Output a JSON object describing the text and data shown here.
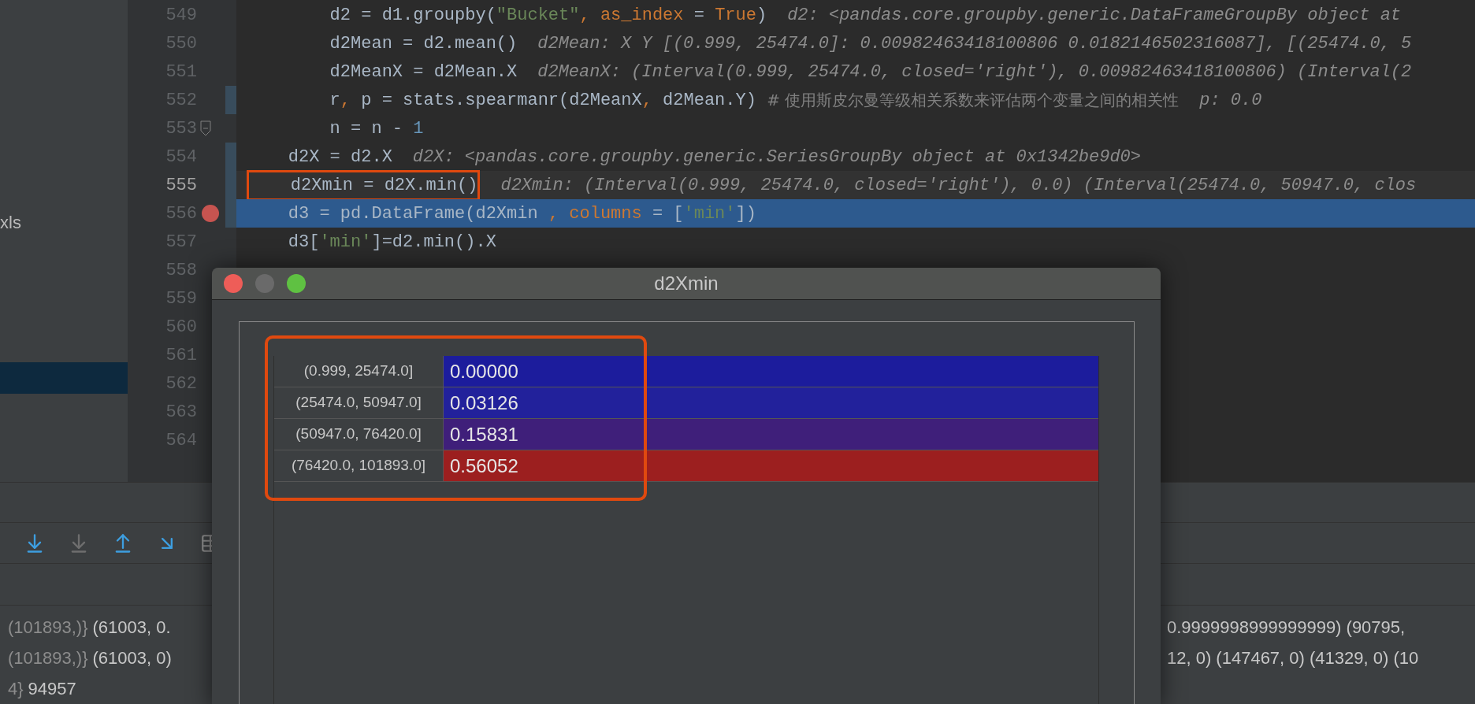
{
  "sidebar": {
    "items": [
      {
        "label": "xls"
      }
    ]
  },
  "editor": {
    "lines": [
      {
        "number": "549",
        "outlined": false,
        "current": false,
        "highlighted": false,
        "breakpoint": false,
        "changed": false,
        "fold": false,
        "tokens": [
          {
            "kind": "code",
            "text": "        d2 = d1.groupby("
          },
          {
            "kind": "str",
            "text": "\"Bucket\""
          },
          {
            "kind": "kw",
            "text": ", as_index"
          },
          {
            "kind": "code",
            "text": " = "
          },
          {
            "kind": "kw",
            "text": "True"
          },
          {
            "kind": "code",
            "text": ")"
          },
          {
            "kind": "hint",
            "text": "d2: <pandas.core.groupby.generic.DataFrameGroupBy object at"
          }
        ]
      },
      {
        "number": "550",
        "outlined": false,
        "current": false,
        "highlighted": false,
        "breakpoint": false,
        "changed": false,
        "fold": false,
        "tokens": [
          {
            "kind": "code",
            "text": "        d2Mean = d2.mean()"
          },
          {
            "kind": "hint",
            "text": "d2Mean: X Y [(0.999, 25474.0]: 0.00982463418100806 0.0182146502316087], [(25474.0, 5"
          }
        ]
      },
      {
        "number": "551",
        "outlined": false,
        "current": false,
        "highlighted": false,
        "breakpoint": false,
        "changed": false,
        "fold": false,
        "tokens": [
          {
            "kind": "code",
            "text": "        d2MeanX = d2Mean.X"
          },
          {
            "kind": "hint",
            "text": "d2MeanX: (Interval(0.999, 25474.0, closed='right'), 0.00982463418100806) (Interval(2"
          }
        ]
      },
      {
        "number": "552",
        "outlined": false,
        "current": false,
        "highlighted": false,
        "breakpoint": false,
        "changed": true,
        "fold": false,
        "tokens": [
          {
            "kind": "code",
            "text": "        r"
          },
          {
            "kind": "kw",
            "text": ","
          },
          {
            "kind": "code",
            "text": " p = stats.spearmanr(d2MeanX"
          },
          {
            "kind": "kw",
            "text": ","
          },
          {
            "kind": "code",
            "text": " d2Mean.Y) "
          },
          {
            "kind": "comment",
            "text": "# 使用斯皮尔曼等级相关系数来评估两个变量之间的相关性"
          },
          {
            "kind": "hint",
            "text": "p: 0.0"
          }
        ]
      },
      {
        "number": "553",
        "outlined": false,
        "current": false,
        "highlighted": false,
        "breakpoint": false,
        "changed": false,
        "fold": true,
        "tokens": [
          {
            "kind": "code",
            "text": "        n = n - "
          },
          {
            "kind": "num",
            "text": "1"
          }
        ]
      },
      {
        "number": "554",
        "outlined": false,
        "current": false,
        "highlighted": false,
        "breakpoint": false,
        "changed": true,
        "fold": false,
        "tokens": [
          {
            "kind": "code",
            "text": "    d2X = d2.X"
          },
          {
            "kind": "hint",
            "text": "d2X: <pandas.core.groupby.generic.SeriesGroupBy object at 0x1342be9d0>"
          }
        ]
      },
      {
        "number": "555",
        "outlined": true,
        "current": true,
        "highlighted": false,
        "breakpoint": false,
        "changed": true,
        "fold": false,
        "tokens": [
          {
            "kind": "code",
            "text": "    d2Xmin = d2X.min()"
          },
          {
            "kind": "hint",
            "text": "d2Xmin: (Interval(0.999, 25474.0, closed='right'), 0.0) (Interval(25474.0, 50947.0, clos"
          }
        ]
      },
      {
        "number": "556",
        "outlined": false,
        "current": false,
        "highlighted": true,
        "breakpoint": true,
        "changed": true,
        "fold": false,
        "tokens": [
          {
            "kind": "code",
            "text": "    d3 = pd.DataFrame(d2Xmin "
          },
          {
            "kind": "kw",
            "text": ", columns"
          },
          {
            "kind": "code",
            "text": " = ["
          },
          {
            "kind": "str",
            "text": "'min'"
          },
          {
            "kind": "code",
            "text": "])"
          }
        ]
      },
      {
        "number": "557",
        "outlined": false,
        "current": false,
        "highlighted": false,
        "breakpoint": false,
        "changed": false,
        "fold": false,
        "tokens": [
          {
            "kind": "code",
            "text": "    d3["
          },
          {
            "kind": "str",
            "text": "'min'"
          },
          {
            "kind": "code",
            "text": "]=d2.min().X"
          }
        ]
      },
      {
        "number": "558",
        "outlined": false,
        "current": false,
        "highlighted": false,
        "breakpoint": false,
        "changed": false,
        "fold": false
      },
      {
        "number": "559",
        "outlined": false,
        "current": false,
        "highlighted": false,
        "breakpoint": false,
        "changed": false,
        "fold": false
      },
      {
        "number": "560",
        "outlined": false,
        "current": false,
        "highlighted": false,
        "breakpoint": false,
        "changed": false,
        "fold": false
      },
      {
        "number": "561",
        "outlined": false,
        "current": false,
        "highlighted": false,
        "breakpoint": false,
        "changed": false,
        "fold": false
      },
      {
        "number": "562",
        "outlined": false,
        "current": false,
        "highlighted": false,
        "breakpoint": false,
        "changed": false,
        "fold": false
      },
      {
        "number": "563",
        "outlined": false,
        "current": false,
        "highlighted": false,
        "breakpoint": false,
        "changed": false,
        "fold": false
      },
      {
        "number": "564",
        "outlined": false,
        "current": false,
        "highlighted": false,
        "breakpoint": false,
        "changed": false,
        "fold": false
      }
    ]
  },
  "variables": {
    "rows": [
      {
        "left": [
          {
            "kind": "dim",
            "text": "(101893,)}"
          },
          {
            "kind": "value",
            "text": "(61003, 0."
          }
        ],
        "right": "0.9999998999999999) (90795,"
      },
      {
        "left": [
          {
            "kind": "dim",
            "text": "(101893,)}"
          },
          {
            "kind": "value",
            "text": "(61003, 0)"
          }
        ],
        "right": "12, 0) (147467, 0) (41329, 0) (10"
      },
      {
        "left": [
          {
            "kind": "dim",
            "text": "4}"
          },
          {
            "kind": "value",
            "text": "94957"
          }
        ]
      }
    ]
  },
  "dialog": {
    "title": "d2Xmin",
    "rows": [
      {
        "index": "(0.999, 25474.0]",
        "value": "0.00000",
        "color": "#1c1c9c"
      },
      {
        "index": "(25474.0, 50947.0]",
        "value": "0.03126",
        "color": "#22219b"
      },
      {
        "index": "(50947.0, 76420.0]",
        "value": "0.15831",
        "color": "#3f1f7a"
      },
      {
        "index": "(76420.0, 101893.0]",
        "value": "0.56052",
        "color": "#9c1f1f"
      }
    ]
  }
}
